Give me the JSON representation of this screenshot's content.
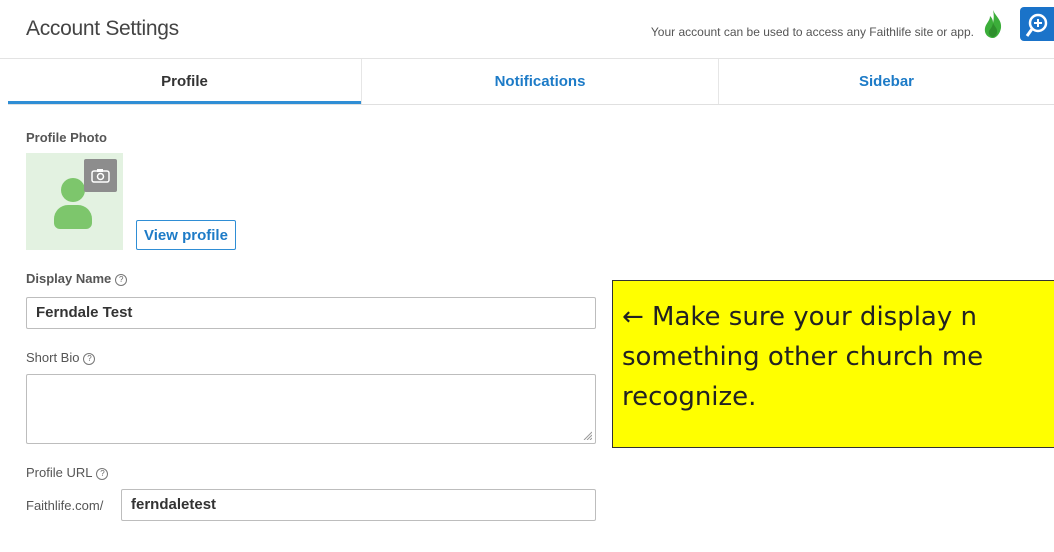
{
  "header": {
    "title": "Account Settings",
    "note": "Your account can be used to access any Faithlife site or app.",
    "icons": [
      "flame-icon",
      "app-search-icon"
    ]
  },
  "tabs": [
    {
      "label": "Profile",
      "active": true
    },
    {
      "label": "Notifications",
      "active": false
    },
    {
      "label": "Sidebar",
      "active": false
    }
  ],
  "profile_photo": {
    "label": "Profile Photo",
    "view_profile_label": "View profile",
    "icons": [
      "avatar-icon",
      "camera-icon"
    ]
  },
  "display_name": {
    "label": "Display Name",
    "value": "Ferndale Test"
  },
  "short_bio": {
    "label": "Short Bio",
    "value": ""
  },
  "profile_url": {
    "label": "Profile URL",
    "prefix": "Faithlife.com/",
    "value": "ferndaletest"
  },
  "callout": {
    "text": "← Make sure your display n\nsomething other church me\nrecognize."
  },
  "colors": {
    "accent": "#1d7bc7",
    "avatar": "#7dc66c",
    "callout_bg": "#ffff00",
    "flame": "#3cae3a"
  }
}
